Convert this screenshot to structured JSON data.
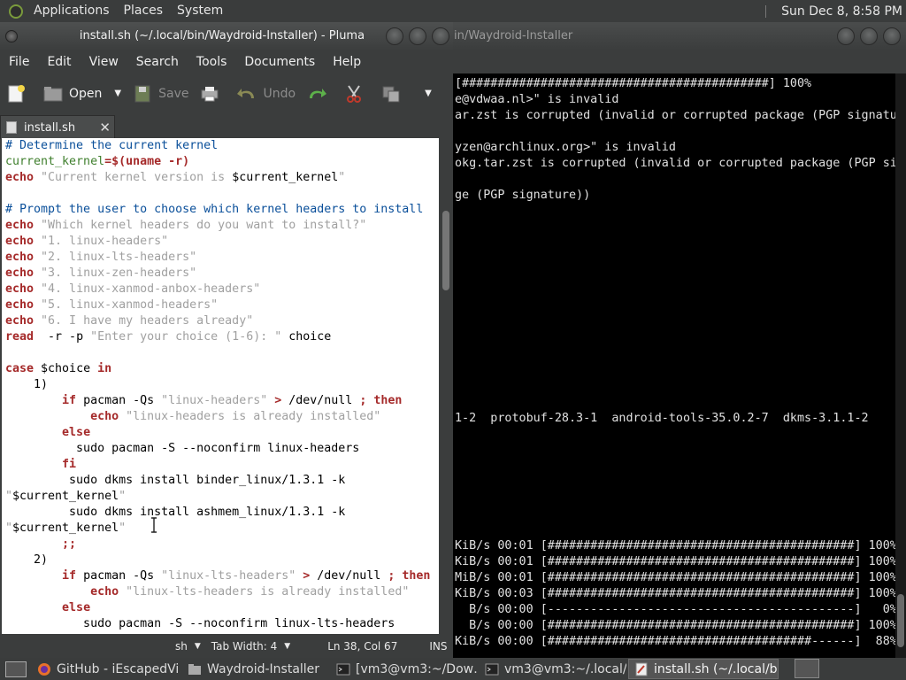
{
  "top_panel": {
    "menus": [
      "Applications",
      "Places",
      "System"
    ],
    "clock": "Sun Dec  8,  8:58 PM"
  },
  "terminal": {
    "title": "in/Waydroid-Installer",
    "lines": [
      "[###########################################] 100%",
      "e@vdwaa.nl>\" is invalid",
      "ar.zst is corrupted (invalid or corrupted package (PGP signatu",
      "",
      "yzen@archlinux.org>\" is invalid",
      "okg.tar.zst is corrupted (invalid or corrupted package (PGP si",
      "",
      "ge (PGP signature))",
      "",
      "",
      "",
      "",
      "",
      "",
      "",
      "",
      "",
      "",
      "",
      "",
      "",
      "1-2  protobuf-28.3-1  android-tools-35.0.2-7  dkms-3.1.1-2",
      "",
      "",
      "",
      "",
      "",
      "",
      "",
      "KiB/s 00:01 [###########################################] 100%",
      "KiB/s 00:01 [###########################################] 100%",
      "MiB/s 00:01 [###########################################] 100%",
      "KiB/s 00:03 [###########################################] 100%",
      "  B/s 00:00 [-------------------------------------------]   0%",
      "  B/s 00:00 [###########################################] 100%",
      "KiB/s 00:00 [#####################################------]  88%"
    ]
  },
  "pluma": {
    "title": "install.sh (~/.local/bin/Waydroid-Installer) - Pluma",
    "menu": [
      "File",
      "Edit",
      "View",
      "Search",
      "Tools",
      "Documents",
      "Help"
    ],
    "toolbar": {
      "open": "Open",
      "save": "Save",
      "undo": "Undo"
    },
    "tab_label": "install.sh",
    "tab_close": "✕",
    "status": {
      "language": "sh",
      "tab_width": "Tab Width:  4",
      "position": "Ln 38, Col 67",
      "mode": "INS"
    }
  },
  "code_lines": [
    [
      [
        "c-com",
        "# Determine the current kernel"
      ]
    ],
    [
      [
        "c-var",
        "current_kernel"
      ],
      [
        "c-op",
        "=$("
      ],
      [
        "c-kw",
        "uname"
      ],
      [
        "c-op",
        " -r)"
      ]
    ],
    [
      [
        "c-kw",
        "echo"
      ],
      [
        "c-str",
        " \"Current kernel version is "
      ],
      [
        "c-var-plain",
        "$current_kernel"
      ],
      [
        "c-str",
        "\""
      ]
    ],
    [],
    [
      [
        "c-com",
        "# Prompt the user to choose which kernel headers to install"
      ]
    ],
    [
      [
        "c-kw",
        "echo"
      ],
      [
        "c-str",
        " \"Which kernel headers do you want to install?\""
      ]
    ],
    [
      [
        "c-kw",
        "echo"
      ],
      [
        "c-str",
        " \"1. linux-headers\""
      ]
    ],
    [
      [
        "c-kw",
        "echo"
      ],
      [
        "c-str",
        " \"2. linux-lts-headers\""
      ]
    ],
    [
      [
        "c-kw",
        "echo"
      ],
      [
        "c-str",
        " \"3. linux-zen-headers\""
      ]
    ],
    [
      [
        "c-kw",
        "echo"
      ],
      [
        "c-str",
        " \"4. linux-xanmod-anbox-headers\""
      ]
    ],
    [
      [
        "c-kw",
        "echo"
      ],
      [
        "c-str",
        " \"5. linux-xanmod-headers\""
      ]
    ],
    [
      [
        "c-kw",
        "echo"
      ],
      [
        "c-str",
        " \"6. I have my headers already\""
      ]
    ],
    [
      [
        "c-kw",
        "read"
      ],
      [
        "",
        "  -r -p "
      ],
      [
        "c-str",
        "\"Enter your choice (1-6): \""
      ],
      [
        "",
        " choice"
      ]
    ],
    [],
    [
      [
        "c-kw",
        "case"
      ],
      [
        "",
        " $choice "
      ],
      [
        "c-kw",
        "in"
      ]
    ],
    [
      [
        "",
        "    1)"
      ]
    ],
    [
      [
        "",
        "        "
      ],
      [
        "c-kw",
        "if"
      ],
      [
        "",
        " pacman -Qs "
      ],
      [
        "c-str",
        "\"linux-headers\""
      ],
      [
        "c-op",
        " >"
      ],
      [
        "",
        " /dev/null "
      ],
      [
        "c-op",
        ";"
      ],
      [
        "",
        " "
      ],
      [
        "c-kw",
        "then"
      ]
    ],
    [
      [
        "",
        "            "
      ],
      [
        "c-kw",
        "echo"
      ],
      [
        "c-str",
        " \"linux-headers is already installed\""
      ]
    ],
    [
      [
        "",
        "        "
      ],
      [
        "c-kw",
        "else"
      ]
    ],
    [
      [
        "",
        "          sudo pacman -S --noconfirm linux-headers"
      ]
    ],
    [
      [
        "",
        "        "
      ],
      [
        "c-kw",
        "fi"
      ]
    ],
    [
      [
        "",
        "         sudo dkms install binder_linux/1.3.1 -k"
      ]
    ],
    [
      [
        "c-str",
        "\""
      ],
      [
        "",
        "$current_kernel"
      ],
      [
        "c-str",
        "\""
      ]
    ],
    [
      [
        "",
        "         sudo dkms install ashmem_linux/1.3.1 -k"
      ]
    ],
    [
      [
        "c-str",
        "\""
      ],
      [
        "",
        "$current_kernel"
      ],
      [
        "c-str",
        "\""
      ]
    ],
    [
      [
        "",
        "        "
      ],
      [
        "c-op",
        ";;"
      ]
    ],
    [
      [
        "",
        "    2)"
      ]
    ],
    [
      [
        "",
        "        "
      ],
      [
        "c-kw",
        "if"
      ],
      [
        "",
        " pacman -Qs "
      ],
      [
        "c-str",
        "\"linux-lts-headers\""
      ],
      [
        "c-op",
        " >"
      ],
      [
        "",
        " /dev/null "
      ],
      [
        "c-op",
        ";"
      ],
      [
        "",
        " "
      ],
      [
        "c-kw",
        "then"
      ]
    ],
    [
      [
        "",
        "            "
      ],
      [
        "c-kw",
        "echo"
      ],
      [
        "c-str",
        " \"linux-lts-headers is already installed\""
      ]
    ],
    [
      [
        "",
        "        "
      ],
      [
        "c-kw",
        "else"
      ]
    ],
    [
      [
        "",
        "           sudo pacman -S --noconfirm linux-lts-headers"
      ]
    ]
  ],
  "taskbar": {
    "items": [
      {
        "label": "GitHub - iEscapedVi…",
        "icon": "firefox-icon"
      },
      {
        "label": "Waydroid-Installer",
        "icon": "folder-icon"
      },
      {
        "label": "[vm3@vm3:~/Dow…",
        "icon": "terminal-icon"
      },
      {
        "label": "vm3@vm3:~/.local/…",
        "icon": "terminal-icon"
      },
      {
        "label": "install.sh (~/.local/bi…",
        "icon": "text-editor-icon"
      }
    ]
  }
}
